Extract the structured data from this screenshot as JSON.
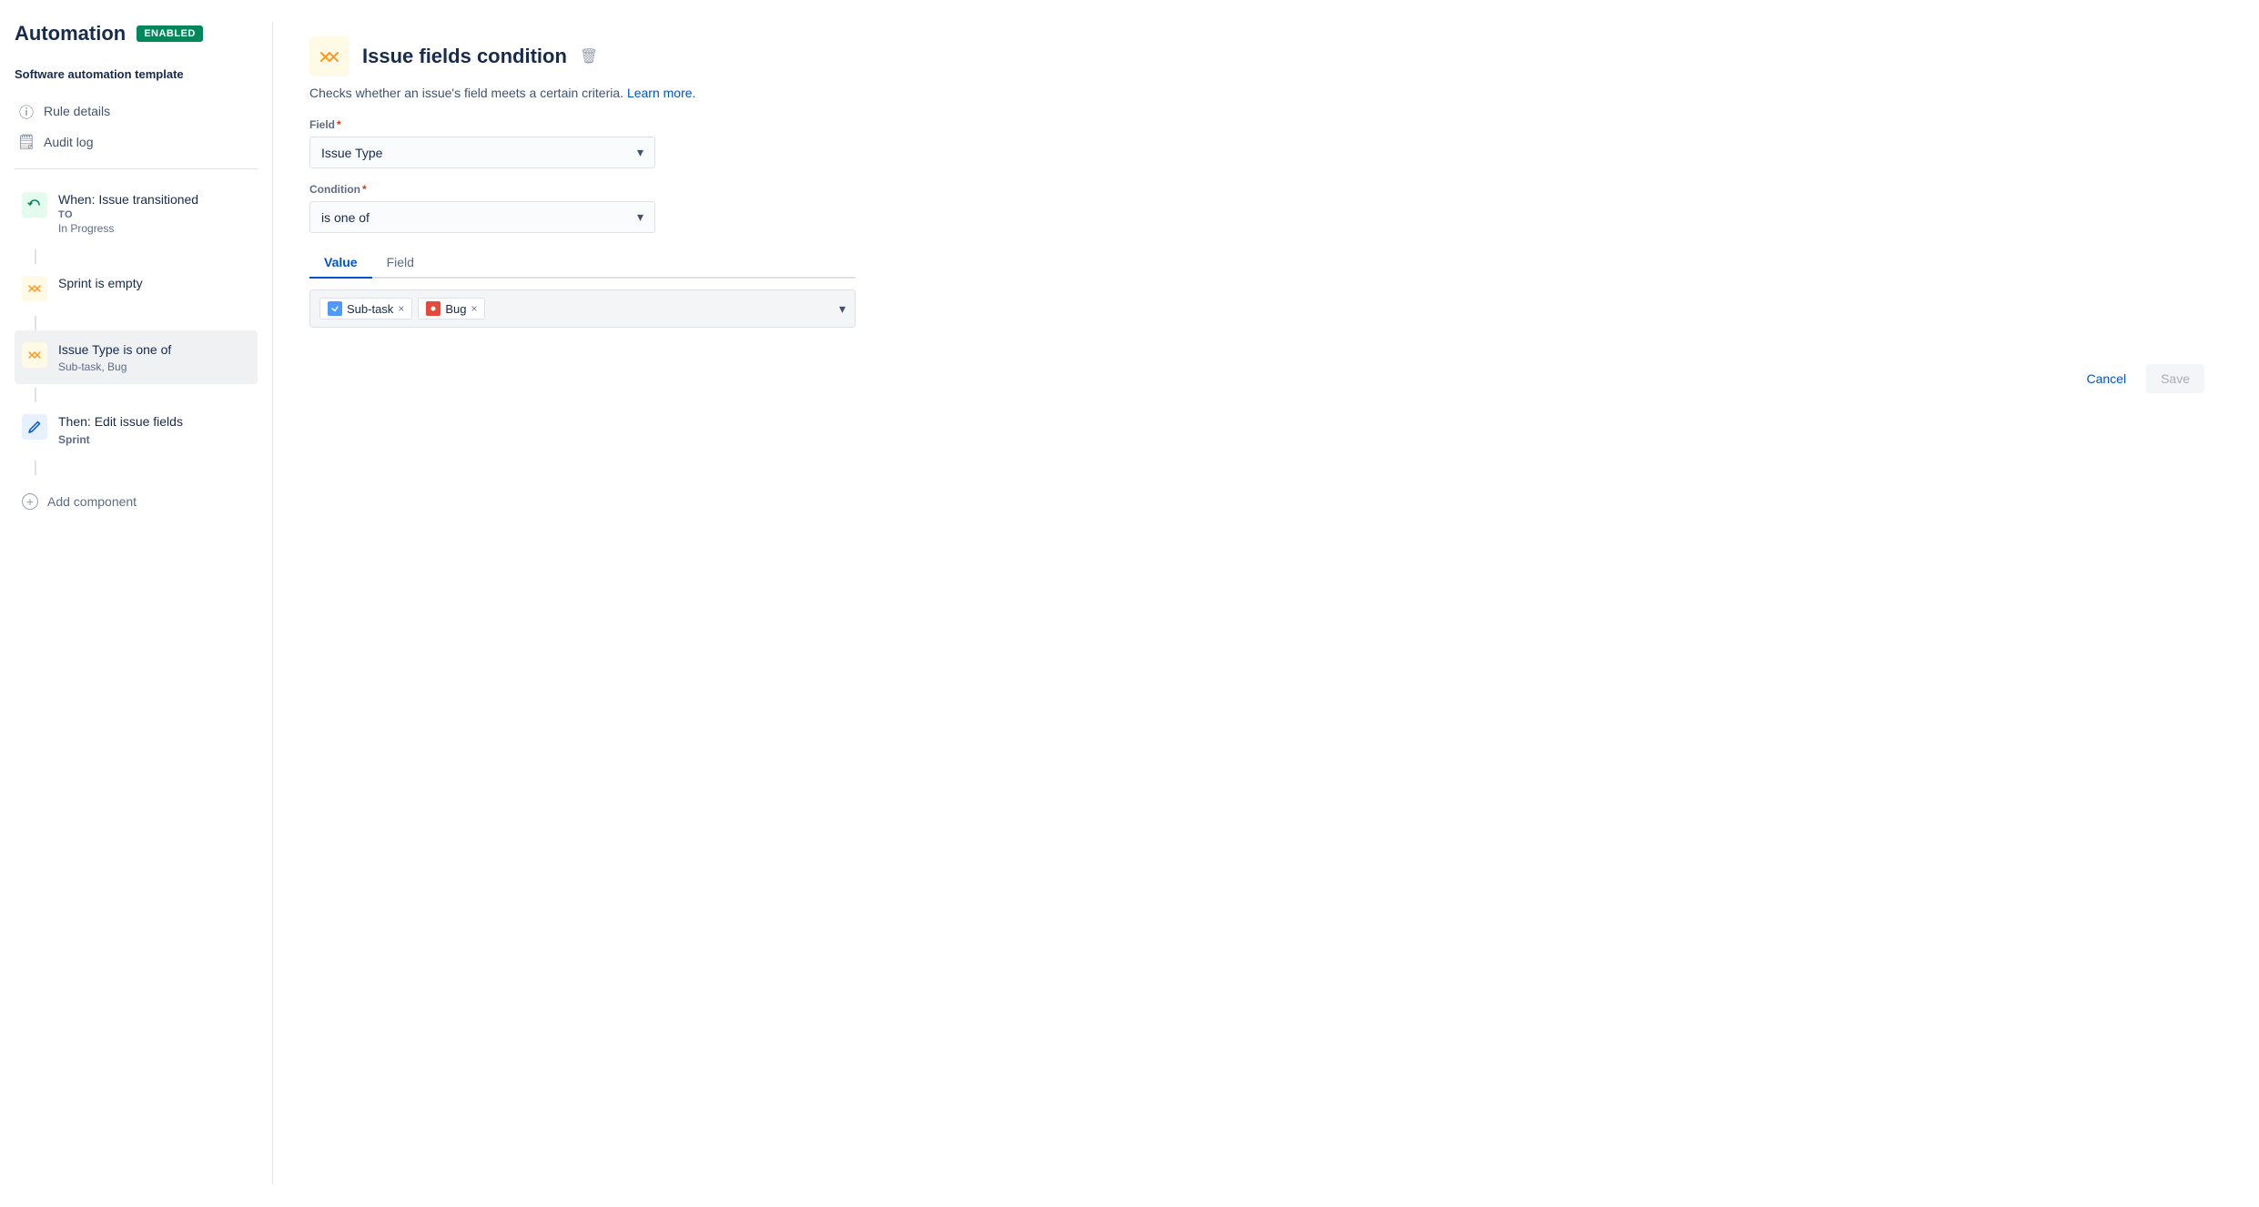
{
  "header": {
    "title": "Automation",
    "badge": "ENABLED"
  },
  "sidebar": {
    "template_label": "Software automation template",
    "nav_items": [
      {
        "id": "rule-details",
        "label": "Rule details",
        "icon": "ℹ"
      },
      {
        "id": "audit-log",
        "label": "Audit log",
        "icon": "📋"
      }
    ],
    "workflow_items": [
      {
        "id": "trigger",
        "type": "trigger",
        "icon": "↩",
        "icon_class": "icon-green",
        "main_label": "When: Issue transitioned",
        "to_label": "TO",
        "sub_label": "In Progress"
      },
      {
        "id": "condition-sprint",
        "type": "condition",
        "icon": "⇄",
        "icon_class": "icon-yellow",
        "main_label": "Sprint is empty",
        "sub_label": ""
      },
      {
        "id": "condition-issue-type",
        "type": "condition",
        "icon": "⇄",
        "icon_class": "icon-yellow",
        "main_label": "Issue Type is one of",
        "sub_label": "Sub-task, Bug",
        "active": true
      },
      {
        "id": "action-edit",
        "type": "action",
        "icon": "✏",
        "icon_class": "icon-blue",
        "main_label": "Then: Edit issue fields",
        "sub_label": "Sprint",
        "sub_label_bold": true
      }
    ],
    "add_component_label": "Add component"
  },
  "main": {
    "condition_title": "Issue fields condition",
    "condition_desc": "Checks whether an issue's field meets a certain criteria.",
    "learn_more_label": "Learn more.",
    "field_label": "Field",
    "field_required": true,
    "field_value": "Issue Type",
    "condition_label": "Condition",
    "condition_required": true,
    "condition_value": "is one of",
    "tabs": [
      {
        "id": "value",
        "label": "Value",
        "active": true
      },
      {
        "id": "field",
        "label": "Field",
        "active": false
      }
    ],
    "tags": [
      {
        "id": "subtask",
        "label": "Sub-task",
        "type": "subtask"
      },
      {
        "id": "bug",
        "label": "Bug",
        "type": "bug"
      }
    ]
  },
  "footer": {
    "cancel_label": "Cancel",
    "save_label": "Save"
  }
}
